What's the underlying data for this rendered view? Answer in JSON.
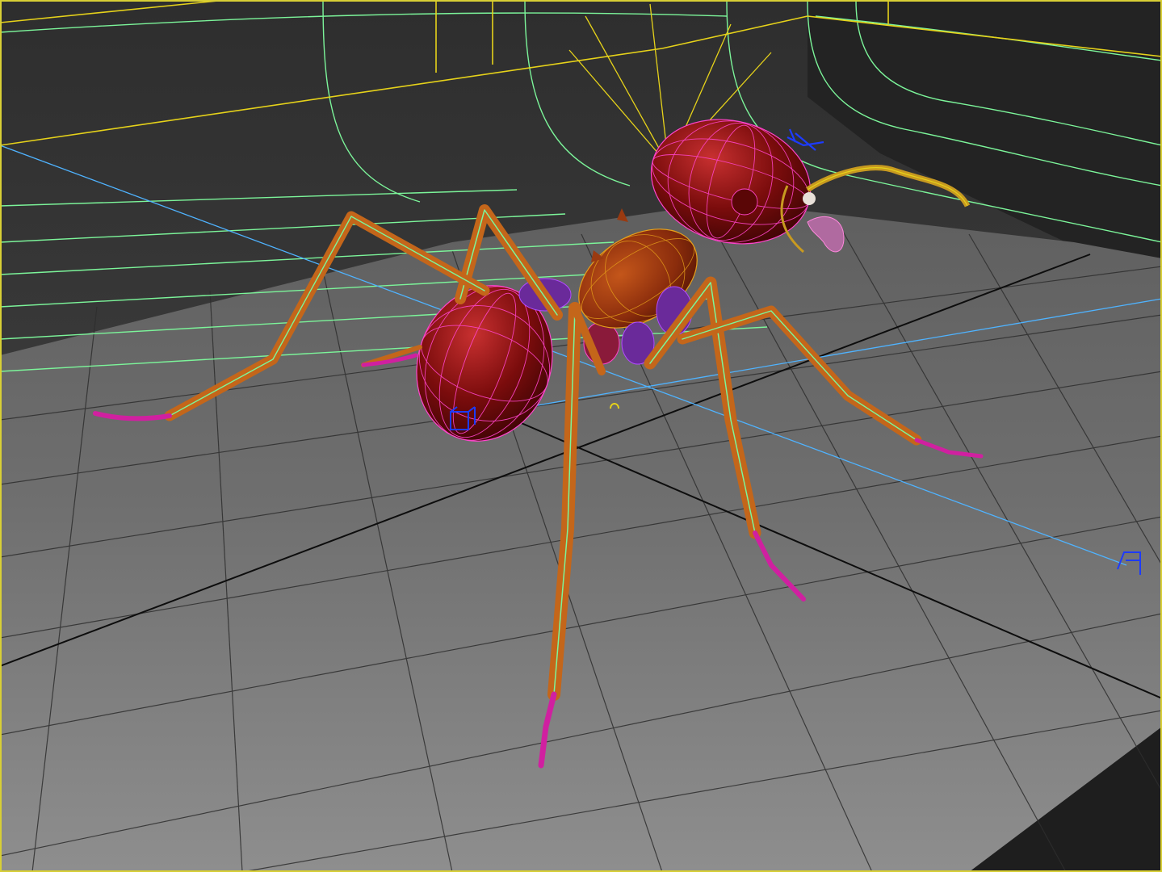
{
  "viewport": {
    "label": "3D viewport",
    "active": true,
    "colors": {
      "floor_near": "#8a8a8a",
      "floor_far": "#5a5a5a",
      "wall_top": "#2b2b2b",
      "wall_mid": "#4a4a4a",
      "grid_line": "#2a2a2a",
      "world_axis": "#0d0d0d",
      "active_border": "#d8cf35",
      "wire_green": "#7cf59a",
      "wire_yellow": "#e6d21a",
      "wire_pink": "#ff44cc",
      "wire_violet": "#b24bff",
      "light_line": "#4fb3ff",
      "helper_blue": "#1d3bff",
      "body_red": "#7a0c0c",
      "leg_orange": "#c46a1a",
      "foot_magenta": "#d020a0"
    }
  },
  "scene": {
    "objects": [
      {
        "name": "ant-head",
        "color": "#7a0c0c"
      },
      {
        "name": "ant-thorax",
        "color": "#9a3a10"
      },
      {
        "name": "ant-abdomen",
        "color": "#7a0c0c"
      },
      {
        "name": "ant-leg",
        "color": "#c46a1a"
      },
      {
        "name": "ant-antenna",
        "color": "#c89a20"
      },
      {
        "name": "backdrop-cyclorama",
        "color": "#7cf59a"
      },
      {
        "name": "spotlight",
        "color": "#e6d21a"
      },
      {
        "name": "camera",
        "color": "#4fb3ff"
      }
    ],
    "icons": [
      "camera-target-icon",
      "light-target-icon",
      "pivot-helper-icon",
      "transform-gizmo-icon"
    ]
  }
}
